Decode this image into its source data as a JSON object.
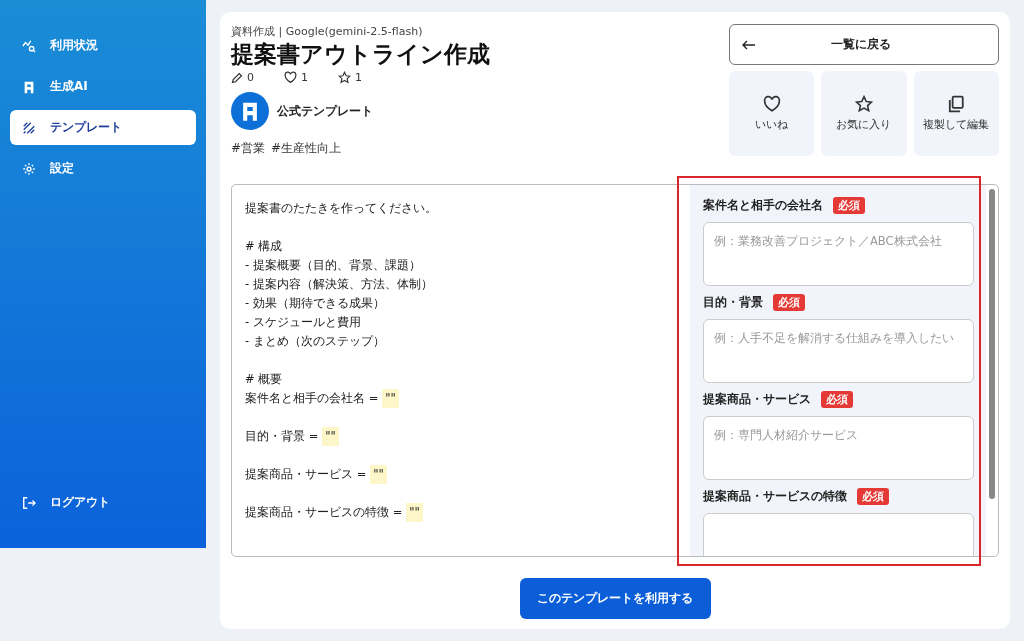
{
  "sidebar": {
    "items": [
      {
        "label": "利用状況",
        "selected": false
      },
      {
        "label": "生成AI",
        "selected": false
      },
      {
        "label": "テンプレート",
        "selected": true
      },
      {
        "label": "設定",
        "selected": false
      }
    ],
    "logout": {
      "label": "ログアウト"
    }
  },
  "header": {
    "category": "資料作成 | Google(gemini-2.5-flash)",
    "title": "提案書アウトライン作成",
    "stats": [
      {
        "count": "0"
      },
      {
        "count": "1"
      },
      {
        "count": "1"
      }
    ],
    "author": "公式テンプレート",
    "tags": [
      "#営業",
      "#生産性向上"
    ]
  },
  "back_button": {
    "label": "一覧に戻る"
  },
  "actions": [
    {
      "label": "いいね"
    },
    {
      "label": "お気に入り"
    },
    {
      "label": "複製して編集"
    }
  ],
  "prompt": {
    "lines": [
      {
        "kind": "text",
        "text": "提案書のたたきを作ってください。"
      },
      {
        "kind": "blank"
      },
      {
        "kind": "text",
        "text": "# 構成"
      },
      {
        "kind": "text",
        "text": "- 提案概要（目的、背景、課題）"
      },
      {
        "kind": "text",
        "text": "- 提案内容（解決策、方法、体制）"
      },
      {
        "kind": "text",
        "text": "- 効果（期待できる成果）"
      },
      {
        "kind": "text",
        "text": "- スケジュールと費用"
      },
      {
        "kind": "text",
        "text": "- まとめ（次のステップ）"
      },
      {
        "kind": "blank"
      },
      {
        "kind": "text",
        "text": "# 概要"
      },
      {
        "kind": "variable",
        "text": "案件名と相手の会社名 =",
        "chip": "\"\""
      },
      {
        "kind": "blank"
      },
      {
        "kind": "variable",
        "text": "目的・背景 =",
        "chip": "\"\""
      },
      {
        "kind": "blank"
      },
      {
        "kind": "variable",
        "text": "提案商品・サービス =",
        "chip": "\"\""
      },
      {
        "kind": "blank"
      },
      {
        "kind": "variable",
        "text": "提案商品・サービスの特徴 =",
        "chip": "\"\""
      }
    ]
  },
  "form": {
    "fields": [
      {
        "label": "案件名と相手の会社名",
        "badge": "必須",
        "placeholder": "例：業務改善プロジェクト／ABC株式会社"
      },
      {
        "label": "目的・背景",
        "badge": "必須",
        "placeholder": "例：人手不足を解消する仕組みを導入したい"
      },
      {
        "label": "提案商品・サービス",
        "badge": "必須",
        "placeholder": "例：専門人材紹介サービス"
      },
      {
        "label": "提案商品・サービスの特徴",
        "badge": "必須"
      }
    ]
  },
  "use_button": {
    "label": "このテンプレートを利用する"
  }
}
